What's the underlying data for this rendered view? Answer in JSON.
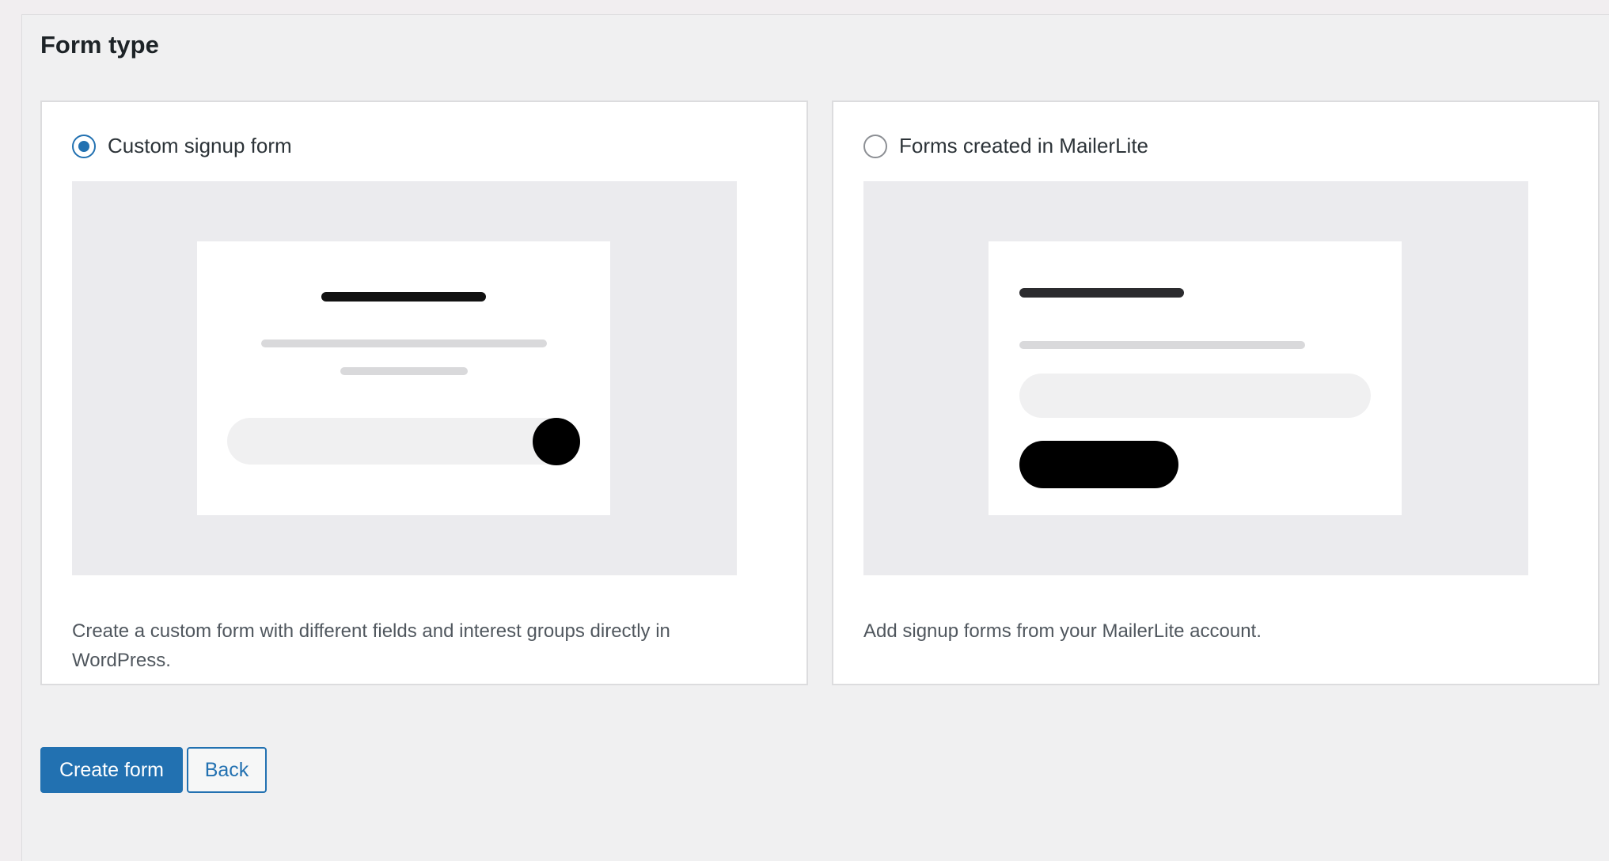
{
  "section": {
    "title": "Form type"
  },
  "options": [
    {
      "id": "custom",
      "label": "Custom signup form",
      "selected": true,
      "description": "Create a custom form with different fields and interest groups directly in WordPress."
    },
    {
      "id": "mailerlite",
      "label": "Forms created in MailerLite",
      "selected": false,
      "description": "Add signup forms from your MailerLite account."
    }
  ],
  "actions": {
    "create_label": "Create form",
    "back_label": "Back"
  },
  "colors": {
    "accent": "#2271b1",
    "preview_bg": "#ebebee",
    "page_bg": "#f0f0f1"
  }
}
